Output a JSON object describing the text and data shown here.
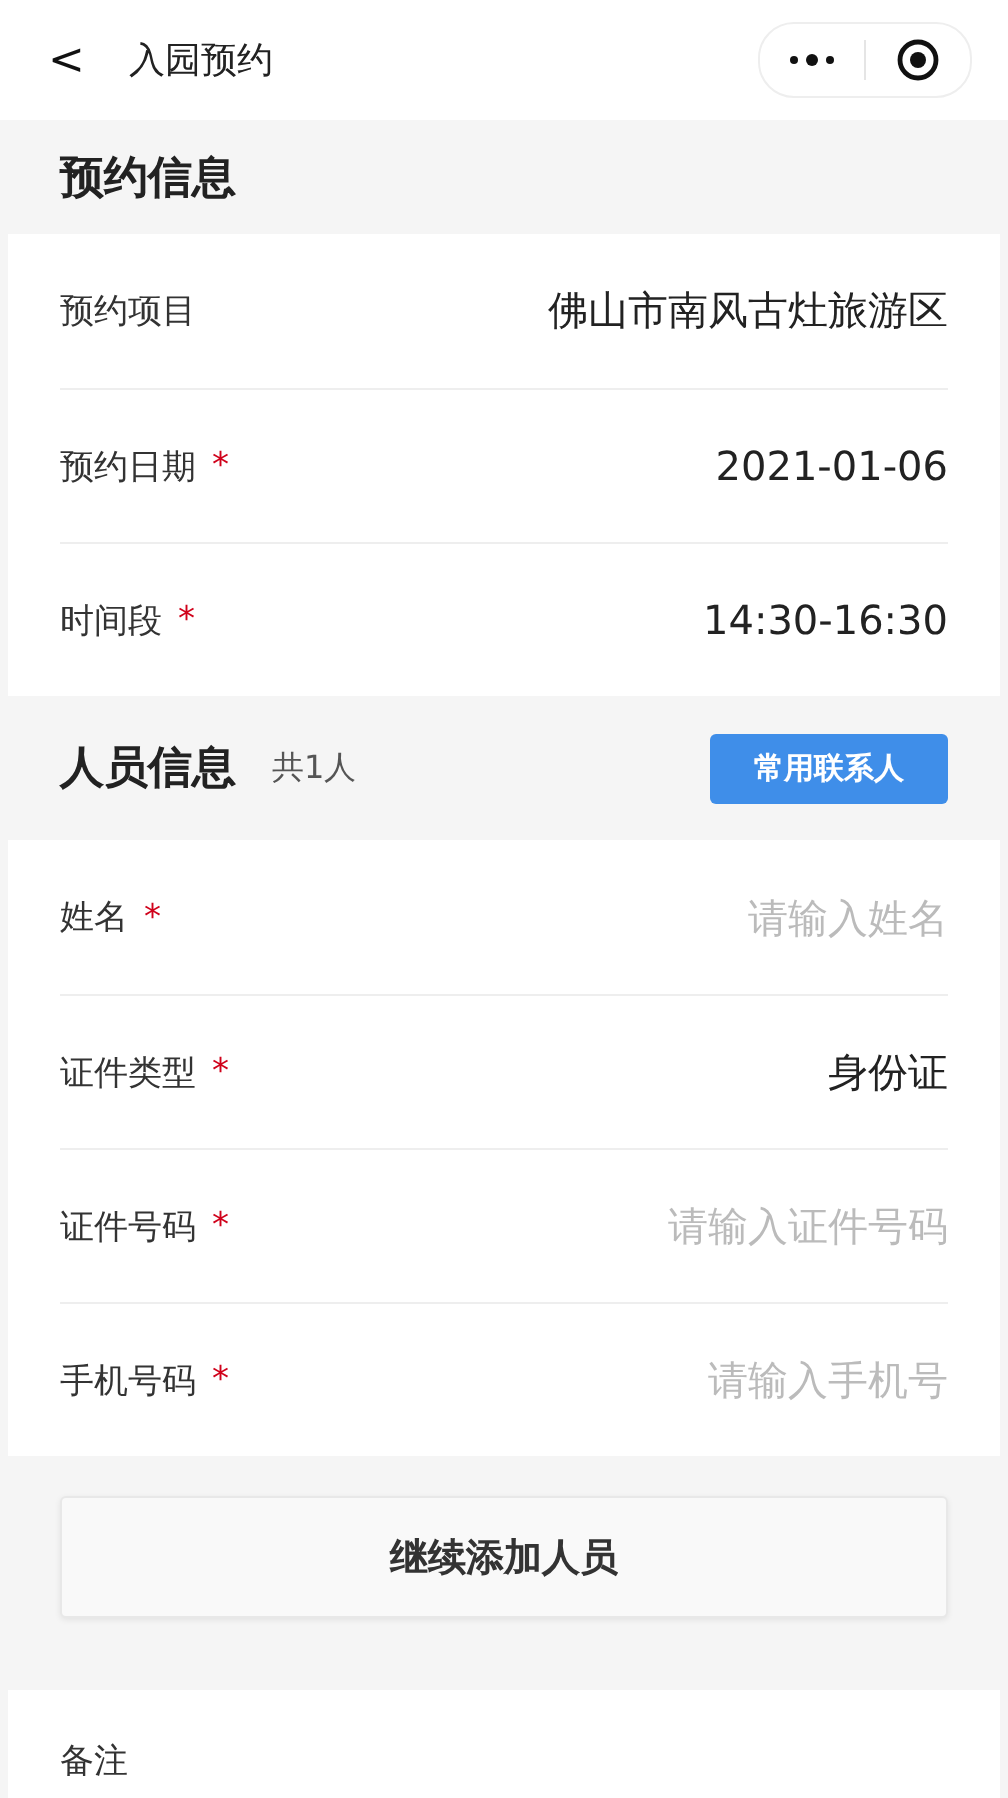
{
  "nav": {
    "back": "<",
    "title": "入园预约"
  },
  "sections": [
    {
      "title": "预约信息",
      "rows": [
        {
          "label": "预约项目",
          "kind": "value",
          "value": "佛山市南风古灶旅游区"
        },
        {
          "label": "预约日期",
          "required_mark": "*",
          "kind": "value",
          "value": "2021-01-06"
        },
        {
          "label": "时间段",
          "required_mark": "*",
          "kind": "value",
          "value": "14:30-16:30"
        }
      ]
    },
    {
      "title": "人员信息",
      "count": "共1人",
      "action": "常用联系人",
      "rows": [
        {
          "label": "姓名",
          "required_mark": "*",
          "kind": "input",
          "placeholder": "请输入姓名"
        },
        {
          "label": "证件类型",
          "required_mark": "*",
          "kind": "value",
          "value": "身份证"
        },
        {
          "label": "证件号码",
          "required_mark": "*",
          "kind": "input",
          "placeholder": "请输入证件号码"
        },
        {
          "label": "手机号码",
          "required_mark": "*",
          "kind": "input",
          "placeholder": "请输入手机号"
        }
      ]
    }
  ],
  "add_button": "继续添加人员",
  "remark": {
    "label": "备注"
  }
}
